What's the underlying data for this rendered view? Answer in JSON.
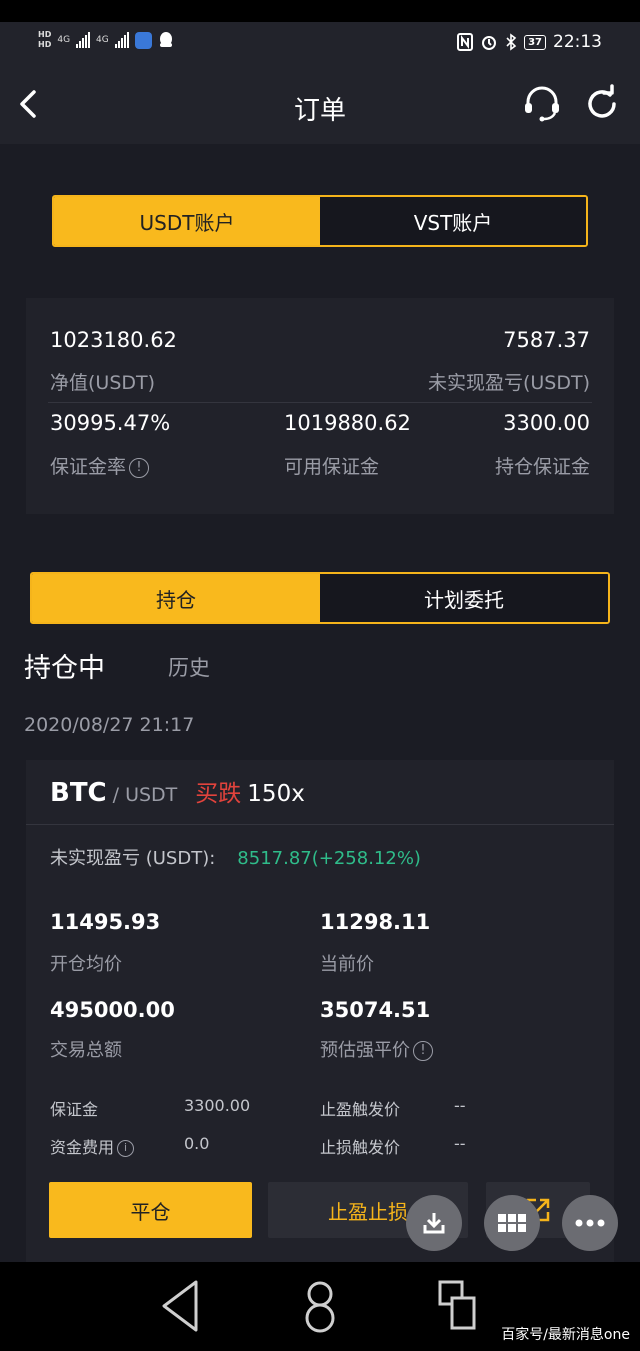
{
  "status_bar": {
    "hd1": "HD",
    "hd2": "HD",
    "net1": "4G",
    "net2": "4G",
    "battery": "37",
    "time": "22:13"
  },
  "header": {
    "title": "订单"
  },
  "account_tabs": [
    {
      "label": "USDT账户",
      "active": true
    },
    {
      "label": "VST账户",
      "active": false
    }
  ],
  "summary": {
    "net_value": "1023180.62",
    "net_value_label": "净值(USDT)",
    "unrealized_pnl": "7587.37",
    "unrealized_pnl_label": "未实现盈亏(USDT)",
    "margin_rate": "30995.47%",
    "margin_rate_label": "保证金率",
    "available_margin": "1019880.62",
    "available_margin_label": "可用保证金",
    "position_margin": "3300.00",
    "position_margin_label": "持仓保证金"
  },
  "position_tabs": [
    {
      "label": "持仓",
      "active": true
    },
    {
      "label": "计划委托",
      "active": false
    }
  ],
  "sub_tabs": {
    "active": "持仓中",
    "inactive": "历史"
  },
  "datetime": "2020/08/27 21:17",
  "position": {
    "symbol": "BTC",
    "quote": "/ USDT",
    "side": "买跌",
    "leverage": "150x",
    "pnl_label": "未实现盈亏 (USDT):",
    "pnl_value": "8517.87(+258.12%)",
    "open_price": "11495.93",
    "open_price_label": "开仓均价",
    "current_price": "11298.11",
    "current_price_label": "当前价",
    "total": "495000.00",
    "total_label": "交易总额",
    "liq_price": "35074.51",
    "liq_price_label": "预估强平价",
    "margin_label": "保证金",
    "margin_value": "3300.00",
    "tp_label": "止盈触发价",
    "tp_value": "--",
    "fee_label": "资金费用",
    "fee_value": "0.0",
    "sl_label": "止损触发价",
    "sl_value": "--",
    "close_button": "平仓",
    "tpsl_button": "止盈止损"
  },
  "watermark": "百家号/最新消息one",
  "colors": {
    "accent": "#f9b91d",
    "background": "#1b1c24",
    "card": "#21222a",
    "sell_red": "#e2433c",
    "profit_green": "#2fbc8a"
  }
}
